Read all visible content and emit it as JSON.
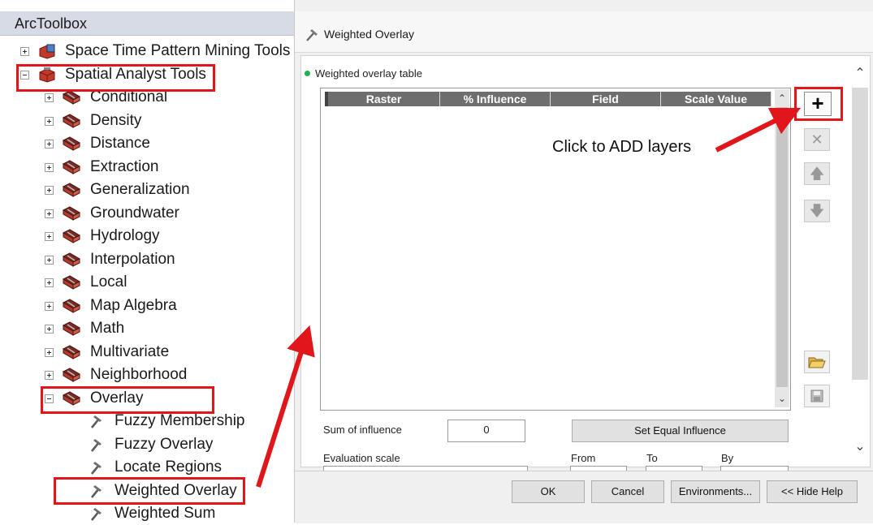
{
  "toolbox": {
    "title": "ArcToolbox",
    "toolsets": [
      {
        "label": "Space Time Pattern Mining Tools",
        "expanded": false
      },
      {
        "label": "Spatial Analyst Tools",
        "expanded": true
      }
    ],
    "spatial_analyst_children": [
      "Conditional",
      "Density",
      "Distance",
      "Extraction",
      "Generalization",
      "Groundwater",
      "Hydrology",
      "Interpolation",
      "Local",
      "Map Algebra",
      "Math",
      "Multivariate",
      "Neighborhood"
    ],
    "overlay": {
      "label": "Overlay",
      "tools": [
        "Fuzzy Membership",
        "Fuzzy Overlay",
        "Locate Regions",
        "Weighted Overlay",
        "Weighted Sum"
      ]
    }
  },
  "dialog": {
    "title": "Weighted Overlay",
    "param_label": "Weighted overlay table",
    "table_columns": [
      "Raster",
      "% Influence",
      "Field",
      "Scale Value"
    ],
    "sum_label": "Sum of influence",
    "sum_value": "0",
    "equal_influence_button": "Set Equal Influence",
    "evaluation_scale_label": "Evaluation scale",
    "from_label": "From",
    "to_label": "To",
    "by_label": "By",
    "buttons": {
      "ok": "OK",
      "cancel": "Cancel",
      "environments": "Environments...",
      "hide_help": "<< Hide Help"
    }
  },
  "annotation": {
    "callout_text": "Click to ADD layers",
    "highlight_color": "#e0161b"
  },
  "colors": {
    "header_bg": "#6e6e6e",
    "status_dot": "#23b14d"
  }
}
